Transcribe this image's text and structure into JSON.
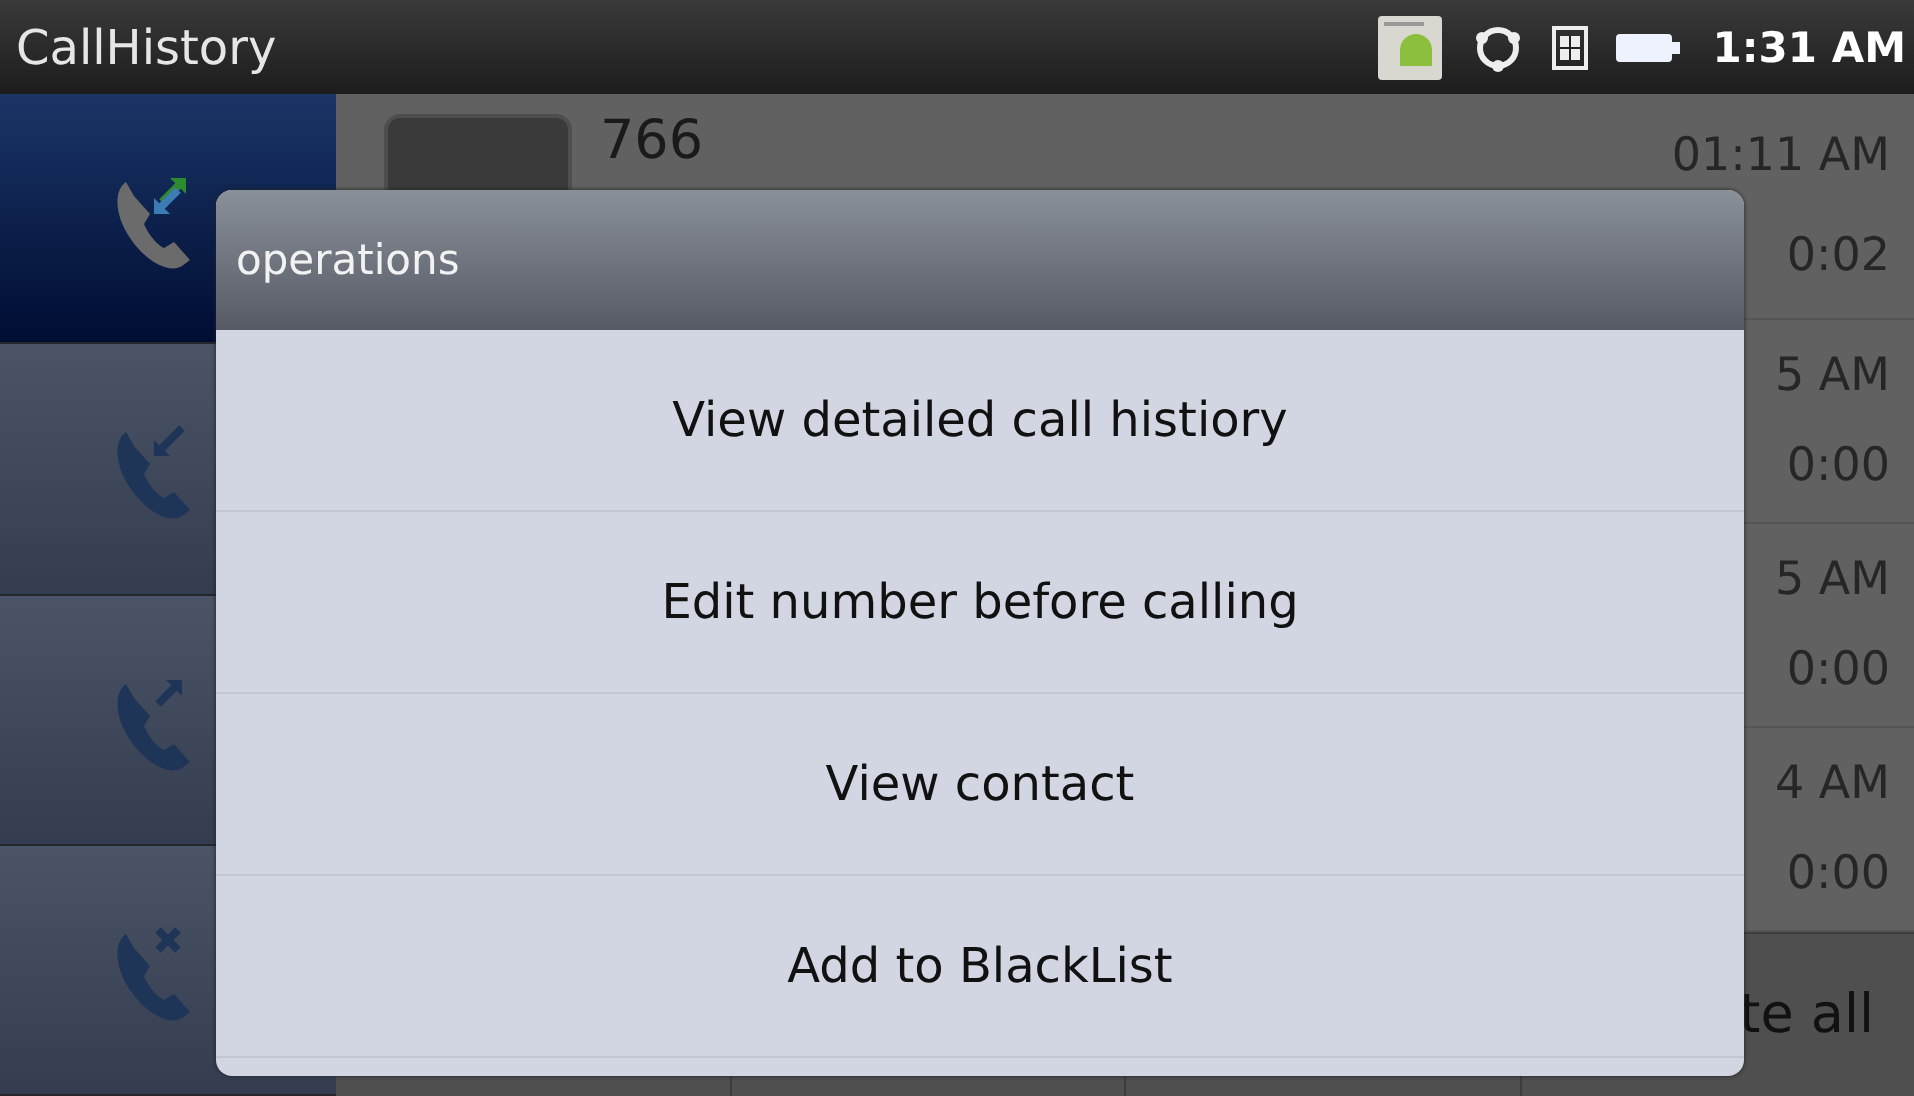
{
  "status_bar": {
    "app_title": "CallHistory",
    "time": "1:31 AM"
  },
  "tabs": [
    {
      "kind": "all",
      "selected": true
    },
    {
      "kind": "incoming",
      "selected": false
    },
    {
      "kind": "outgoing",
      "selected": false
    },
    {
      "kind": "missed",
      "selected": false
    }
  ],
  "calls": [
    {
      "number": "766",
      "time": "01:11 AM",
      "duration": "0:02"
    },
    {
      "time": "5 AM",
      "duration": "0:00"
    },
    {
      "time": "5 AM",
      "duration": "0:00"
    },
    {
      "time": "4 AM",
      "duration": "0:00"
    }
  ],
  "bottom_bar": {
    "button_4": "te all"
  },
  "dialog": {
    "title": "operations",
    "items": [
      "View detailed call histiory",
      "Edit number before calling",
      "View contact",
      "Add to BlackList"
    ]
  }
}
